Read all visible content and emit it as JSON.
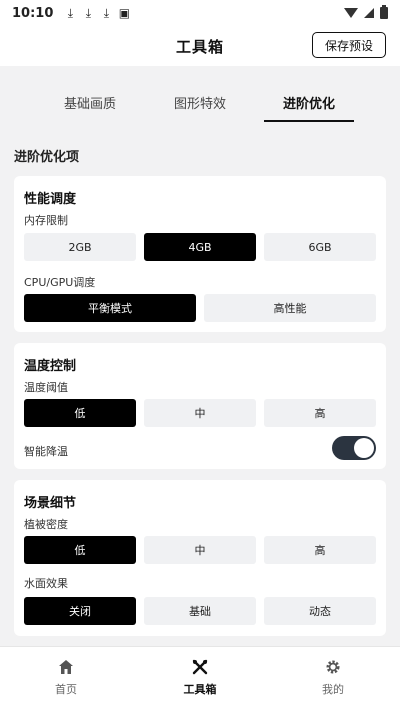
{
  "status_bar": {
    "time": "10:10",
    "download_icons": [
      "download-icon",
      "download-icon",
      "download-icon"
    ],
    "notification_icon": "a-badge-icon"
  },
  "header": {
    "title": "工具箱",
    "save_label": "保存预设"
  },
  "tabs": [
    {
      "label": "基础画质",
      "active": false
    },
    {
      "label": "图形特效",
      "active": false
    },
    {
      "label": "进阶优化",
      "active": true
    }
  ],
  "section_title": "进阶优化项",
  "cards": {
    "performance": {
      "title": "性能调度",
      "memory_label": "内存限制",
      "memory_options": [
        "2GB",
        "4GB",
        "6GB"
      ],
      "memory_selected": "4GB",
      "cpu_label": "CPU/GPU调度",
      "cpu_options": [
        "平衡模式",
        "高性能"
      ],
      "cpu_selected": "平衡模式"
    },
    "temperature": {
      "title": "温度控制",
      "threshold_label": "温度阈值",
      "threshold_options": [
        "低",
        "中",
        "高"
      ],
      "threshold_selected": "低",
      "smart_label": "智能降温",
      "smart_enabled": true
    },
    "scene": {
      "title": "场景细节",
      "vegetation_label": "植被密度",
      "vegetation_options": [
        "低",
        "中",
        "高"
      ],
      "vegetation_selected": "低",
      "water_label": "水面效果",
      "water_options": [
        "关闭",
        "基础",
        "动态"
      ],
      "water_selected": "关闭"
    }
  },
  "bottom_nav": [
    {
      "label": "首页",
      "icon": "home-icon",
      "active": false
    },
    {
      "label": "工具箱",
      "icon": "tools-icon",
      "active": true
    },
    {
      "label": "我的",
      "icon": "gear-icon",
      "active": false
    }
  ]
}
